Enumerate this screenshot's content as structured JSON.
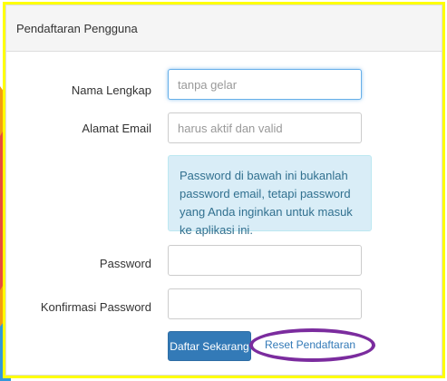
{
  "panel": {
    "title": "Pendaftaran Pengguna"
  },
  "form": {
    "fullname": {
      "label": "Nama Lengkap",
      "value": "",
      "placeholder": "tanpa gelar"
    },
    "email": {
      "label": "Alamat Email",
      "value": "",
      "placeholder": "harus aktif dan valid"
    },
    "info": "Password di bawah ini bukanlah password email, tetapi password yang Anda inginkan untuk masuk ke aplikasi ini.",
    "password": {
      "label": "Password",
      "value": ""
    },
    "password_confirm": {
      "label": "Konfirmasi Password",
      "value": ""
    },
    "submit_label": "Daftar Sekarang",
    "reset_label": "Reset Pendaftaran"
  },
  "colors": {
    "frame_border": "#ffff00",
    "primary": "#337ab7",
    "info_background": "#d9edf7",
    "info_text": "#31708f",
    "highlight": "#7b2c9e"
  }
}
